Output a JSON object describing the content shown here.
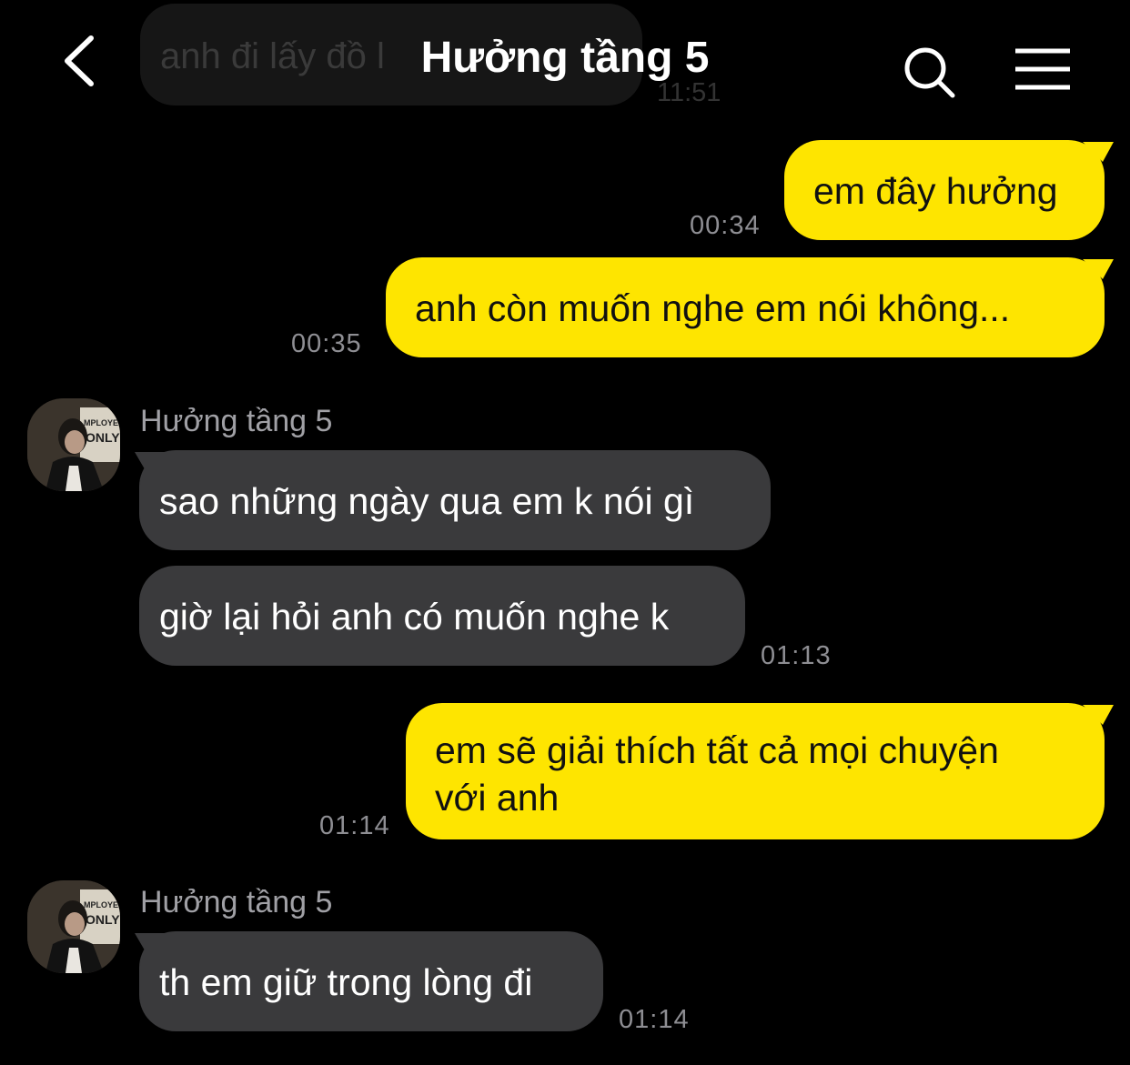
{
  "header": {
    "title": "Hưởng tầng 5",
    "back_icon": "chevron-left-icon",
    "search_icon": "search-icon",
    "menu_icon": "hamburger-menu-icon"
  },
  "previous_message": {
    "text": "anh đi lấy đồ l",
    "time": "11:51"
  },
  "colors": {
    "outgoing_bubble": "#FEE500",
    "incoming_bubble": "#3a3a3c",
    "background": "#000000"
  },
  "messages": [
    {
      "direction": "out",
      "lines": [
        "em đây hưởng"
      ],
      "time": "00:34"
    },
    {
      "direction": "out",
      "lines": [
        "anh còn muốn nghe em nói không..."
      ],
      "time": "00:35"
    },
    {
      "direction": "in",
      "sender": "Hưởng tầng 5",
      "lines": [
        "sao những ngày qua em k nói gì"
      ],
      "time": ""
    },
    {
      "direction": "in",
      "lines": [
        "giờ lại hỏi anh có muốn nghe k"
      ],
      "time": "01:13"
    },
    {
      "direction": "out",
      "lines": [
        "em sẽ giải thích tất cả mọi chuyện",
        "với anh"
      ],
      "time": "01:14"
    },
    {
      "direction": "in",
      "sender": "Hưởng tầng 5",
      "lines": [
        "th em giữ trong lòng đi"
      ],
      "time": "01:14"
    }
  ],
  "avatar": {
    "sign_text": "MPLOYEES ONLY"
  }
}
